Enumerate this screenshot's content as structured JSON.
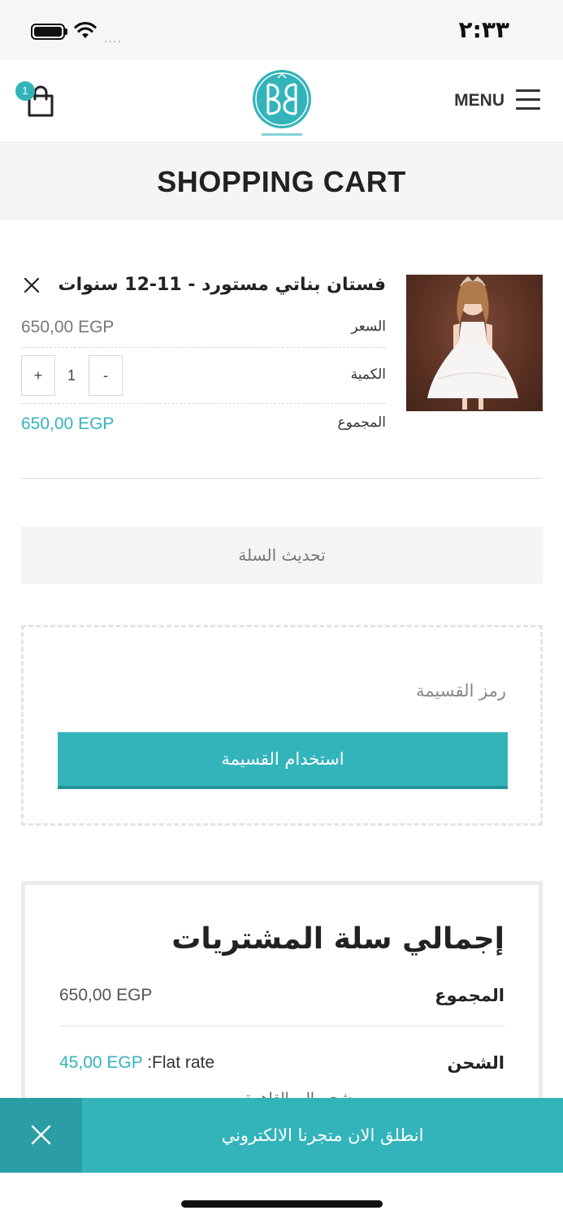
{
  "status_bar": {
    "time": "٢:٣٣",
    "signal_dots": "....",
    "icons": [
      "battery-icon",
      "wifi-icon",
      "signal-icon"
    ]
  },
  "header": {
    "cart_count": "1",
    "menu_label": "MENU",
    "logo_icon": "brand-logo-icon"
  },
  "page_title": "SHOPPING CART",
  "cart_item": {
    "name": "فستان بناتي مستورد - 11-12 سنوات",
    "price_label": "السعر",
    "price_value": "650,00 EGP",
    "quantity_label": "الكمية",
    "quantity_value": "1",
    "qty_minus": "-",
    "qty_plus": "+",
    "subtotal_label": "المجموع",
    "subtotal_value": "650,00 EGP"
  },
  "update_cart_label": "تحديث السلة",
  "coupon": {
    "placeholder": "رمز القسيمة",
    "apply_label": "استخدام القسيمة"
  },
  "totals": {
    "title": "إجمالي سلة المشتريات",
    "subtotal_label": "المجموع",
    "subtotal_value": "650,00 EGP",
    "shipping_label": "الشحن",
    "shipping_method": ":Flat rate",
    "shipping_value": "45,00 EGP",
    "shipping_note": "شحن إلى القاهرة"
  },
  "banner": {
    "text": "انطلق الان متجرنا الالكتروني"
  },
  "colors": {
    "accent": "#33b4bb",
    "accent_dark": "#2a9ea4",
    "text": "#222222",
    "muted": "#777777"
  }
}
